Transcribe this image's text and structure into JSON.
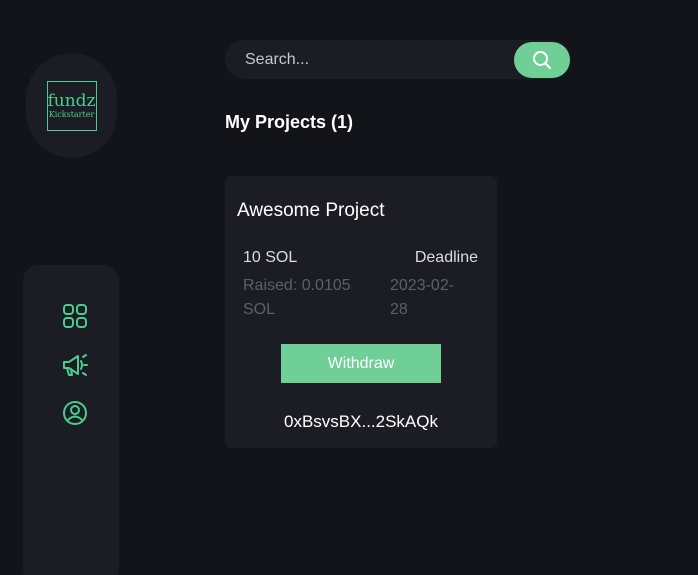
{
  "logo": {
    "main": "fundz",
    "sub": "Kickstarter"
  },
  "sidebar": {
    "items": [
      {
        "icon": "dashboard-grid-icon"
      },
      {
        "icon": "megaphone-icon"
      },
      {
        "icon": "user-profile-icon"
      }
    ]
  },
  "search": {
    "placeholder": "Search...",
    "value": ""
  },
  "section": {
    "title": "My Projects (1)"
  },
  "projects": [
    {
      "title": "Awesome Project",
      "target": "10 SOL",
      "raised": "Raised: 0.0105 SOL",
      "deadline_label": "Deadline",
      "deadline": "2023-02-28",
      "action_label": "Withdraw",
      "address": "0xBsvsBX...2SkAQk"
    }
  ],
  "colors": {
    "background": "#13131a",
    "panel": "#1c1c24",
    "accent": "#6fcf97",
    "icon": "#4acd8d",
    "muted": "#5f5f6a"
  }
}
